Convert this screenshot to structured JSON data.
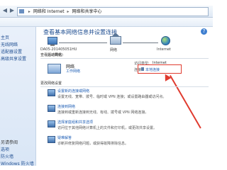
{
  "address_bar": {
    "path": [
      "网络和 Internet",
      "网络和共享中心"
    ]
  },
  "left_nav": {
    "links": [
      "主页",
      "无线网络",
      "适配器设置",
      "高级共享设置"
    ],
    "see_also": [
      "另请参阅",
      "选项",
      "防火墙",
      "Windows 防火墙"
    ]
  },
  "main": {
    "page_title": "查看基本网络信息并设置连接",
    "help_icon": "?",
    "map": {
      "computer_name": "DA05-201405051HU",
      "computer_sub": "(此计算机)",
      "network_label": "网络",
      "internet_label": "Internet"
    },
    "active": {
      "section_label": "查看活动网络",
      "name": "网络",
      "type": "工作网络",
      "access_label": "访问类型:",
      "access_value": "Internet",
      "connections_label": "连接:",
      "connections_value": "本地连接"
    },
    "change": {
      "section_label": "更改网络设置",
      "tasks": [
        {
          "title": "设置新的连接或网络",
          "desc": "设置无线、宽带、拨号、临时或 VPN 连接；或设置路由器或访问点。"
        },
        {
          "title": "连接到网络",
          "desc": "连接到或重新连接到无线、有线、拨号或 VPN 网络连接。"
        },
        {
          "title": "选择家庭组和共享选项",
          "desc": "访问位于其他网络计算机上的文件和打印机，或更改共享设置。"
        },
        {
          "title": "疑难解答",
          "desc": "诊断并修复网络问题，或获得故障排除信息。"
        }
      ]
    }
  }
}
